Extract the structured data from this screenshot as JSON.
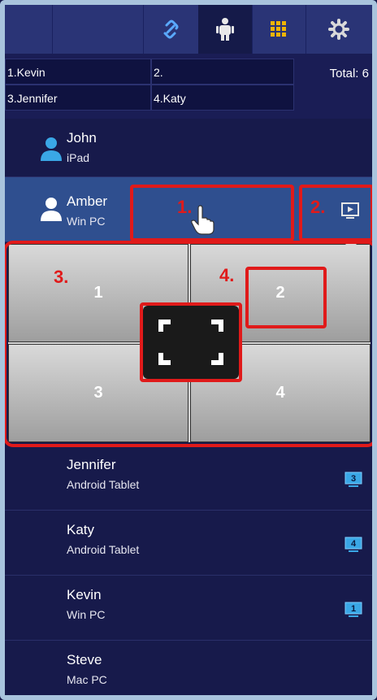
{
  "toolbar": {
    "tabs": [
      {
        "name": "tab-blank-1"
      },
      {
        "name": "tab-blank-2"
      },
      {
        "name": "tab-link",
        "icon": "link-icon"
      },
      {
        "name": "tab-users",
        "icon": "users-icon",
        "active": true
      },
      {
        "name": "tab-grid",
        "icon": "grid-icon"
      },
      {
        "name": "tab-settings",
        "icon": "gear-icon"
      }
    ]
  },
  "presenters": {
    "slots": [
      "1.Kevin",
      "2.",
      "3.Jennifer",
      "4.Katy"
    ],
    "total": "Total: 6"
  },
  "users": [
    {
      "name": "John",
      "device": "iPad"
    },
    {
      "name": "Amber",
      "device": "Win PC"
    },
    {
      "name": "Jennifer",
      "device": "Android Tablet",
      "quadrant": "3"
    },
    {
      "name": "Katy",
      "device": "Android Tablet",
      "quadrant": "4"
    },
    {
      "name": "Kevin",
      "device": "Win PC",
      "quadrant": "1"
    },
    {
      "name": "Steve",
      "device": "Mac PC"
    }
  ],
  "panel": {
    "quadrants": [
      "1",
      "2",
      "3",
      "4"
    ]
  },
  "annotations": [
    "1.",
    "2.",
    "3.",
    "4."
  ],
  "colors": {
    "background": "#171a4b",
    "toolbar": "#2a3476",
    "highlight": "#2f4f8f",
    "annotation": "#e01a1a"
  }
}
